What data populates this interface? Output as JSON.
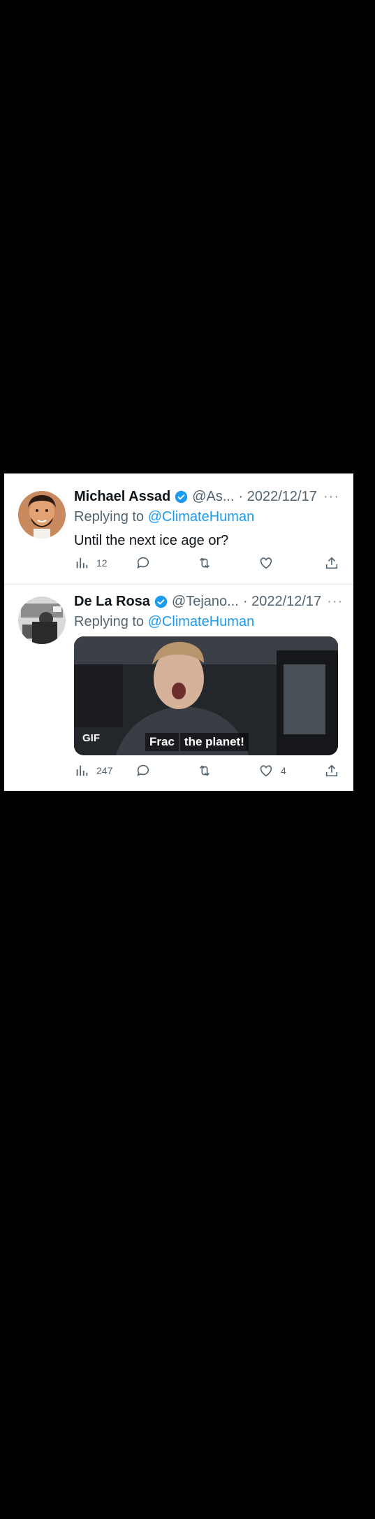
{
  "tweets": [
    {
      "name": "Michael Assad",
      "handle": "@As...",
      "date": "· 2022/12/17",
      "more": "···",
      "replying_prefix": "Replying to ",
      "replying_to": "@ClimateHuman",
      "text": "Until the next ice age or?",
      "views": "12",
      "replies": "",
      "retweets": "",
      "likes": ""
    },
    {
      "name": "De La Rosa",
      "handle": "@Tejano...",
      "date": "· 2022/12/17",
      "more": "···",
      "replying_prefix": "Replying to ",
      "replying_to": "@ClimateHuman",
      "media": {
        "badge": "GIF",
        "caption_1": "Frac",
        "caption_2": "the planet!"
      },
      "views": "247",
      "replies": "",
      "retweets": "",
      "likes": "4"
    }
  ],
  "colors": {
    "accent": "#1d9bf0",
    "text": "#0f1419",
    "secondary": "#536471",
    "background": "#000000"
  },
  "icons": [
    "verified-badge-icon",
    "views-icon",
    "reply-icon",
    "retweet-icon",
    "like-icon",
    "share-icon"
  ]
}
